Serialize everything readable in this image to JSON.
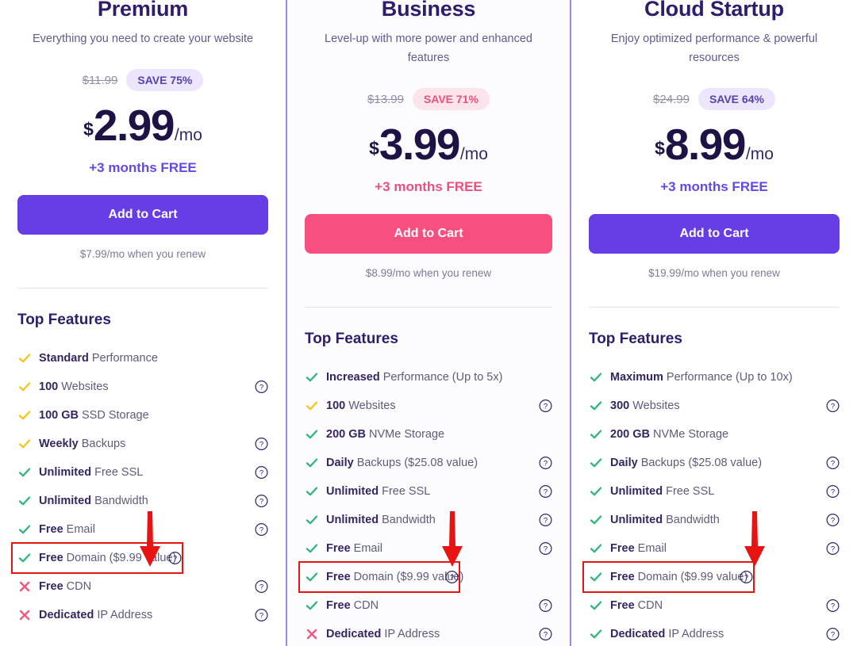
{
  "plans": [
    {
      "name": "Premium",
      "description": "Everything you need to create your website",
      "old_price": "$11.99",
      "save_badge": "SAVE 75%",
      "currency": "$",
      "price": "2.99",
      "period": "/mo",
      "months_free": "+3 months FREE",
      "cta_label": "Add to Cart",
      "renew_note": "$7.99/mo when you renew",
      "features_title": "Top Features",
      "accent": "#673de6",
      "badge_style": "purple",
      "features": [
        {
          "mark": "check-yellow",
          "bold": "Standard",
          "rest": " Performance",
          "help": false
        },
        {
          "mark": "check-yellow",
          "bold": "100",
          "rest": " Websites",
          "help": true
        },
        {
          "mark": "check-yellow",
          "bold": "100 GB",
          "rest": " SSD Storage",
          "help": false
        },
        {
          "mark": "check-yellow",
          "bold": "Weekly",
          "rest": " Backups",
          "help": true
        },
        {
          "mark": "check-green",
          "bold": "Unlimited",
          "rest": " Free SSL",
          "help": true
        },
        {
          "mark": "check-green",
          "bold": "Unlimited",
          "rest": " Bandwidth",
          "help": true
        },
        {
          "mark": "check-green",
          "bold": "Free",
          "rest": " Email",
          "help": true
        },
        {
          "mark": "check-green",
          "bold": "Free",
          "rest": " Domain ($9.99 value)",
          "help": true,
          "highlighted": true
        },
        {
          "mark": "cross-pink",
          "bold": "Free",
          "rest": " CDN",
          "help": true
        },
        {
          "mark": "cross-pink",
          "bold": "Dedicated",
          "rest": " IP Address",
          "help": true
        }
      ]
    },
    {
      "name": "Business",
      "description": "Level-up with more power and enhanced features",
      "old_price": "$13.99",
      "save_badge": "SAVE 71%",
      "currency": "$",
      "price": "3.99",
      "period": "/mo",
      "months_free": "+3 months FREE",
      "cta_label": "Add to Cart",
      "renew_note": "$8.99/mo when you renew",
      "features_title": "Top Features",
      "accent": "#f74f7f",
      "badge_style": "pink",
      "features": [
        {
          "mark": "check-green",
          "bold": "Increased",
          "rest": " Performance (Up to 5x)",
          "help": false
        },
        {
          "mark": "check-yellow",
          "bold": "100",
          "rest": " Websites",
          "help": true
        },
        {
          "mark": "check-green",
          "bold": "200 GB",
          "rest": " NVMe Storage",
          "help": false
        },
        {
          "mark": "check-green",
          "bold": "Daily",
          "rest": " Backups ($25.08 value)",
          "help": true
        },
        {
          "mark": "check-green",
          "bold": "Unlimited",
          "rest": " Free SSL",
          "help": true
        },
        {
          "mark": "check-green",
          "bold": "Unlimited",
          "rest": " Bandwidth",
          "help": true
        },
        {
          "mark": "check-green",
          "bold": "Free",
          "rest": " Email",
          "help": true
        },
        {
          "mark": "check-green",
          "bold": "Free",
          "rest": " Domain ($9.99 value)",
          "help": true,
          "highlighted": true
        },
        {
          "mark": "check-green",
          "bold": "Free",
          "rest": " CDN",
          "help": true
        },
        {
          "mark": "cross-pink",
          "bold": "Dedicated",
          "rest": " IP Address",
          "help": true
        }
      ]
    },
    {
      "name": "Cloud Startup",
      "description": "Enjoy optimized performance & powerful resources",
      "old_price": "$24.99",
      "save_badge": "SAVE 64%",
      "currency": "$",
      "price": "8.99",
      "period": "/mo",
      "months_free": "+3 months FREE",
      "cta_label": "Add to Cart",
      "renew_note": "$19.99/mo when you renew",
      "features_title": "Top Features",
      "accent": "#673de6",
      "badge_style": "purple",
      "features": [
        {
          "mark": "check-green",
          "bold": "Maximum",
          "rest": " Performance (Up to 10x)",
          "help": false
        },
        {
          "mark": "check-green",
          "bold": "300",
          "rest": " Websites",
          "help": true
        },
        {
          "mark": "check-green",
          "bold": "200 GB",
          "rest": " NVMe Storage",
          "help": false
        },
        {
          "mark": "check-green",
          "bold": "Daily",
          "rest": " Backups ($25.08 value)",
          "help": true
        },
        {
          "mark": "check-green",
          "bold": "Unlimited",
          "rest": " Free SSL",
          "help": true
        },
        {
          "mark": "check-green",
          "bold": "Unlimited",
          "rest": " Bandwidth",
          "help": true
        },
        {
          "mark": "check-green",
          "bold": "Free",
          "rest": " Email",
          "help": true
        },
        {
          "mark": "check-green",
          "bold": "Free",
          "rest": " Domain ($9.99 value)",
          "help": true,
          "highlighted": true
        },
        {
          "mark": "check-green",
          "bold": "Free",
          "rest": " CDN",
          "help": true
        },
        {
          "mark": "check-green",
          "bold": "Dedicated",
          "rest": " IP Address",
          "help": true
        }
      ]
    }
  ],
  "annotation": {
    "color": "#e81313",
    "arrow_icon": "down-arrow-icon",
    "highlight_target": "Free Domain ($9.99 value)"
  },
  "colors": {
    "check_green": "#2eb67d",
    "check_yellow": "#f5c518",
    "cross_pink": "#f2577d",
    "title": "#2f1c6a",
    "purple": "#673de6",
    "pink": "#f74f7f"
  }
}
